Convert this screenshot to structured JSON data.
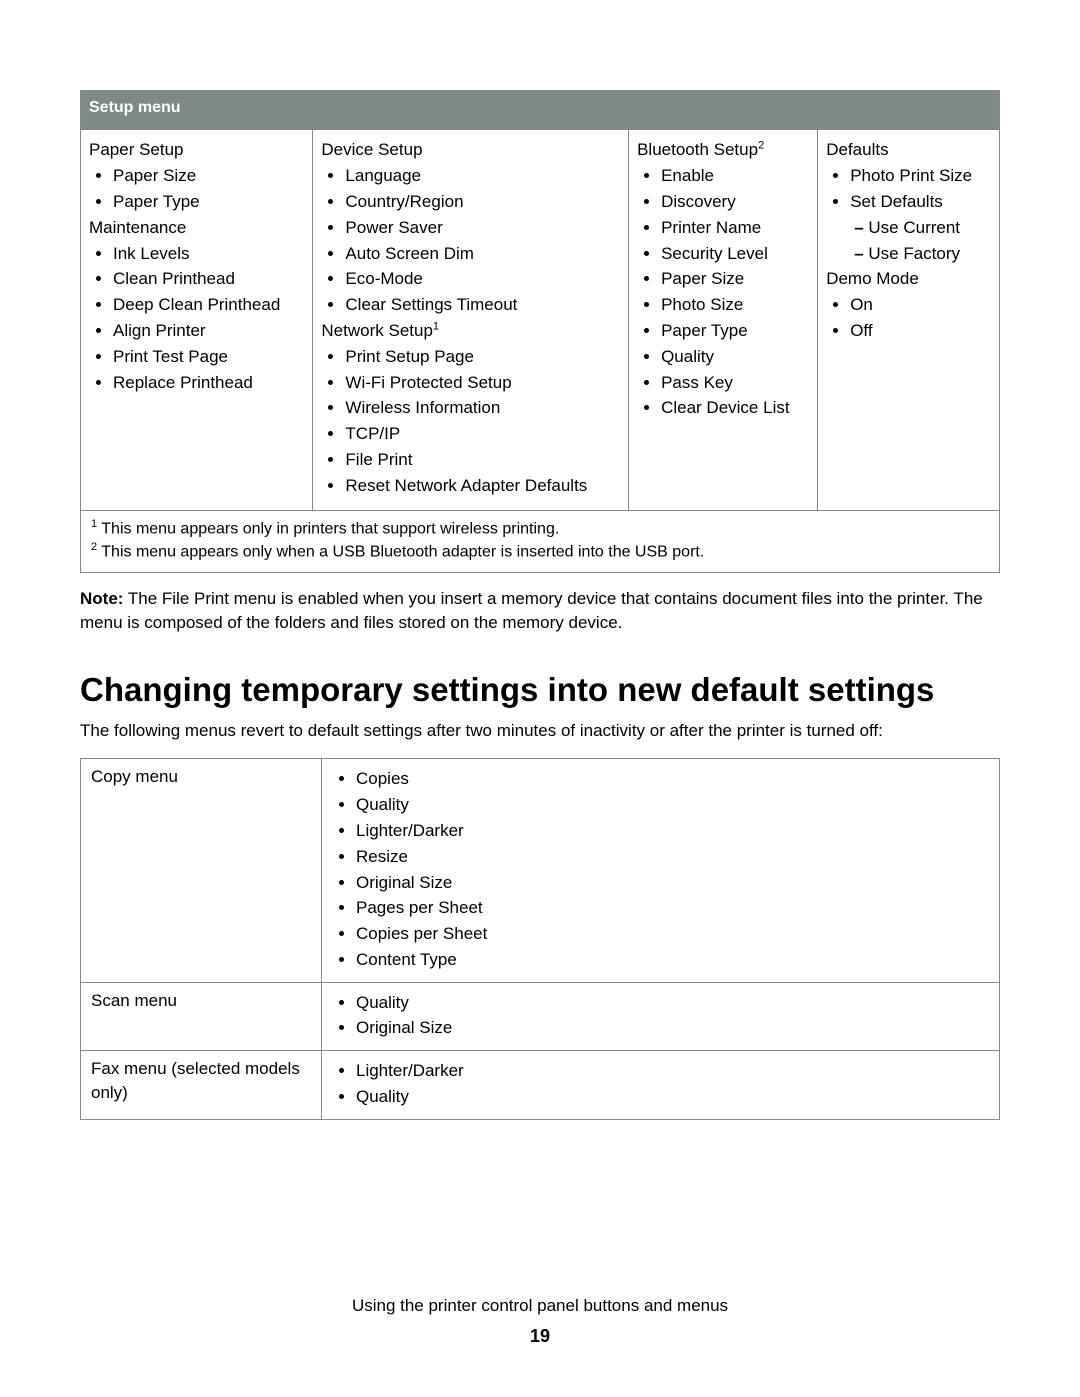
{
  "setup": {
    "header": "Setup menu",
    "col1": {
      "g1": {
        "title": "Paper Setup",
        "items": [
          "Paper Size",
          "Paper Type"
        ]
      },
      "g2": {
        "title": "Maintenance",
        "items": [
          "Ink Levels",
          "Clean Printhead",
          "Deep Clean Printhead",
          "Align Printer",
          "Print Test Page",
          "Replace Printhead"
        ]
      }
    },
    "col2": {
      "g1": {
        "title": "Device Setup",
        "items": [
          "Language",
          "Country/Region",
          "Power Saver",
          "Auto Screen Dim",
          "Eco-Mode",
          "Clear Settings Timeout"
        ]
      },
      "g2": {
        "title": "Network Setup",
        "sup": "1",
        "items": [
          "Print Setup Page",
          "Wi-Fi Protected Setup",
          "Wireless Information",
          "TCP/IP",
          "File Print",
          "Reset Network Adapter Defaults"
        ]
      }
    },
    "col3": {
      "g1": {
        "title": "Bluetooth Setup",
        "sup": "2",
        "items": [
          "Enable",
          "Discovery",
          "Printer Name",
          "Security Level",
          "Paper Size",
          "Photo Size",
          "Paper Type",
          "Quality",
          "Pass Key",
          "Clear Device List"
        ]
      }
    },
    "col4": {
      "g1": {
        "title": "Defaults",
        "items": [
          "Photo Print Size",
          "Set Defaults"
        ],
        "sub": [
          "Use Current",
          "Use Factory"
        ]
      },
      "g2": {
        "title": "Demo Mode",
        "items": [
          "On",
          "Off"
        ]
      }
    },
    "footnotes": {
      "f1": {
        "sup": "1",
        "text": " This menu appears only in printers that support wireless printing."
      },
      "f2": {
        "sup": "2",
        "text": " This menu appears only when a USB Bluetooth adapter is inserted into the USB port."
      }
    }
  },
  "note": {
    "label": "Note:",
    "text": " The File Print menu is enabled when you insert a memory device that contains document files into the printer. The menu is composed of the folders and files stored on the memory device."
  },
  "section_title": "Changing temporary settings into new default settings",
  "intro": "The following menus revert to default settings after two minutes of inactivity or after the printer is turned off:",
  "menus": {
    "row1": {
      "label": "Copy menu",
      "items": [
        "Copies",
        "Quality",
        "Lighter/Darker",
        "Resize",
        "Original Size",
        "Pages per Sheet",
        "Copies per Sheet",
        "Content Type"
      ]
    },
    "row2": {
      "label": "Scan menu",
      "items": [
        "Quality",
        "Original Size"
      ]
    },
    "row3": {
      "label": "Fax menu (selected models only)",
      "items": [
        "Lighter/Darker",
        "Quality"
      ]
    }
  },
  "footer": {
    "line": "Using the printer control panel buttons and menus",
    "page": "19"
  }
}
